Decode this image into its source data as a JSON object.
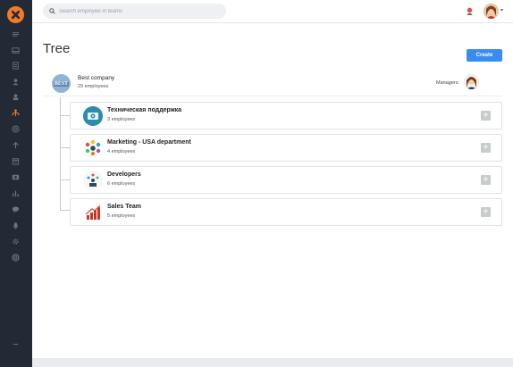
{
  "search": {
    "placeholder": "Search employee in teams"
  },
  "page": {
    "title": "Tree",
    "create_label": "Create"
  },
  "company": {
    "name": "Best company",
    "count": "29 employees",
    "logo_text": "BEST",
    "managers_label": "Managers:"
  },
  "teams": [
    {
      "name": "Техническая поддержка",
      "count": "3 employees",
      "icon": "support-team-logo"
    },
    {
      "name": "Marketing - USA department",
      "count": "4 employees",
      "icon": "marketing-team-logo"
    },
    {
      "name": "Developers",
      "count": "6 employees",
      "icon": "developers-team-logo"
    },
    {
      "name": "Sales Team",
      "count": "5 employees",
      "icon": "sales-team-logo"
    }
  ],
  "sidebar": {
    "items": [
      "menu-icon",
      "inbox-icon",
      "document-icon",
      "person-icon",
      "user-icon",
      "org-tree-icon",
      "target-icon",
      "upload-icon",
      "calendar-icon",
      "media-icon",
      "chart-icon",
      "chat-icon",
      "bell-icon",
      "settings-icon",
      "help-icon"
    ]
  },
  "colors": {
    "accent": "#3b8cf0",
    "sidebar": "#232a36",
    "logo": "#f47a24",
    "active_icon": "#f47a24"
  }
}
